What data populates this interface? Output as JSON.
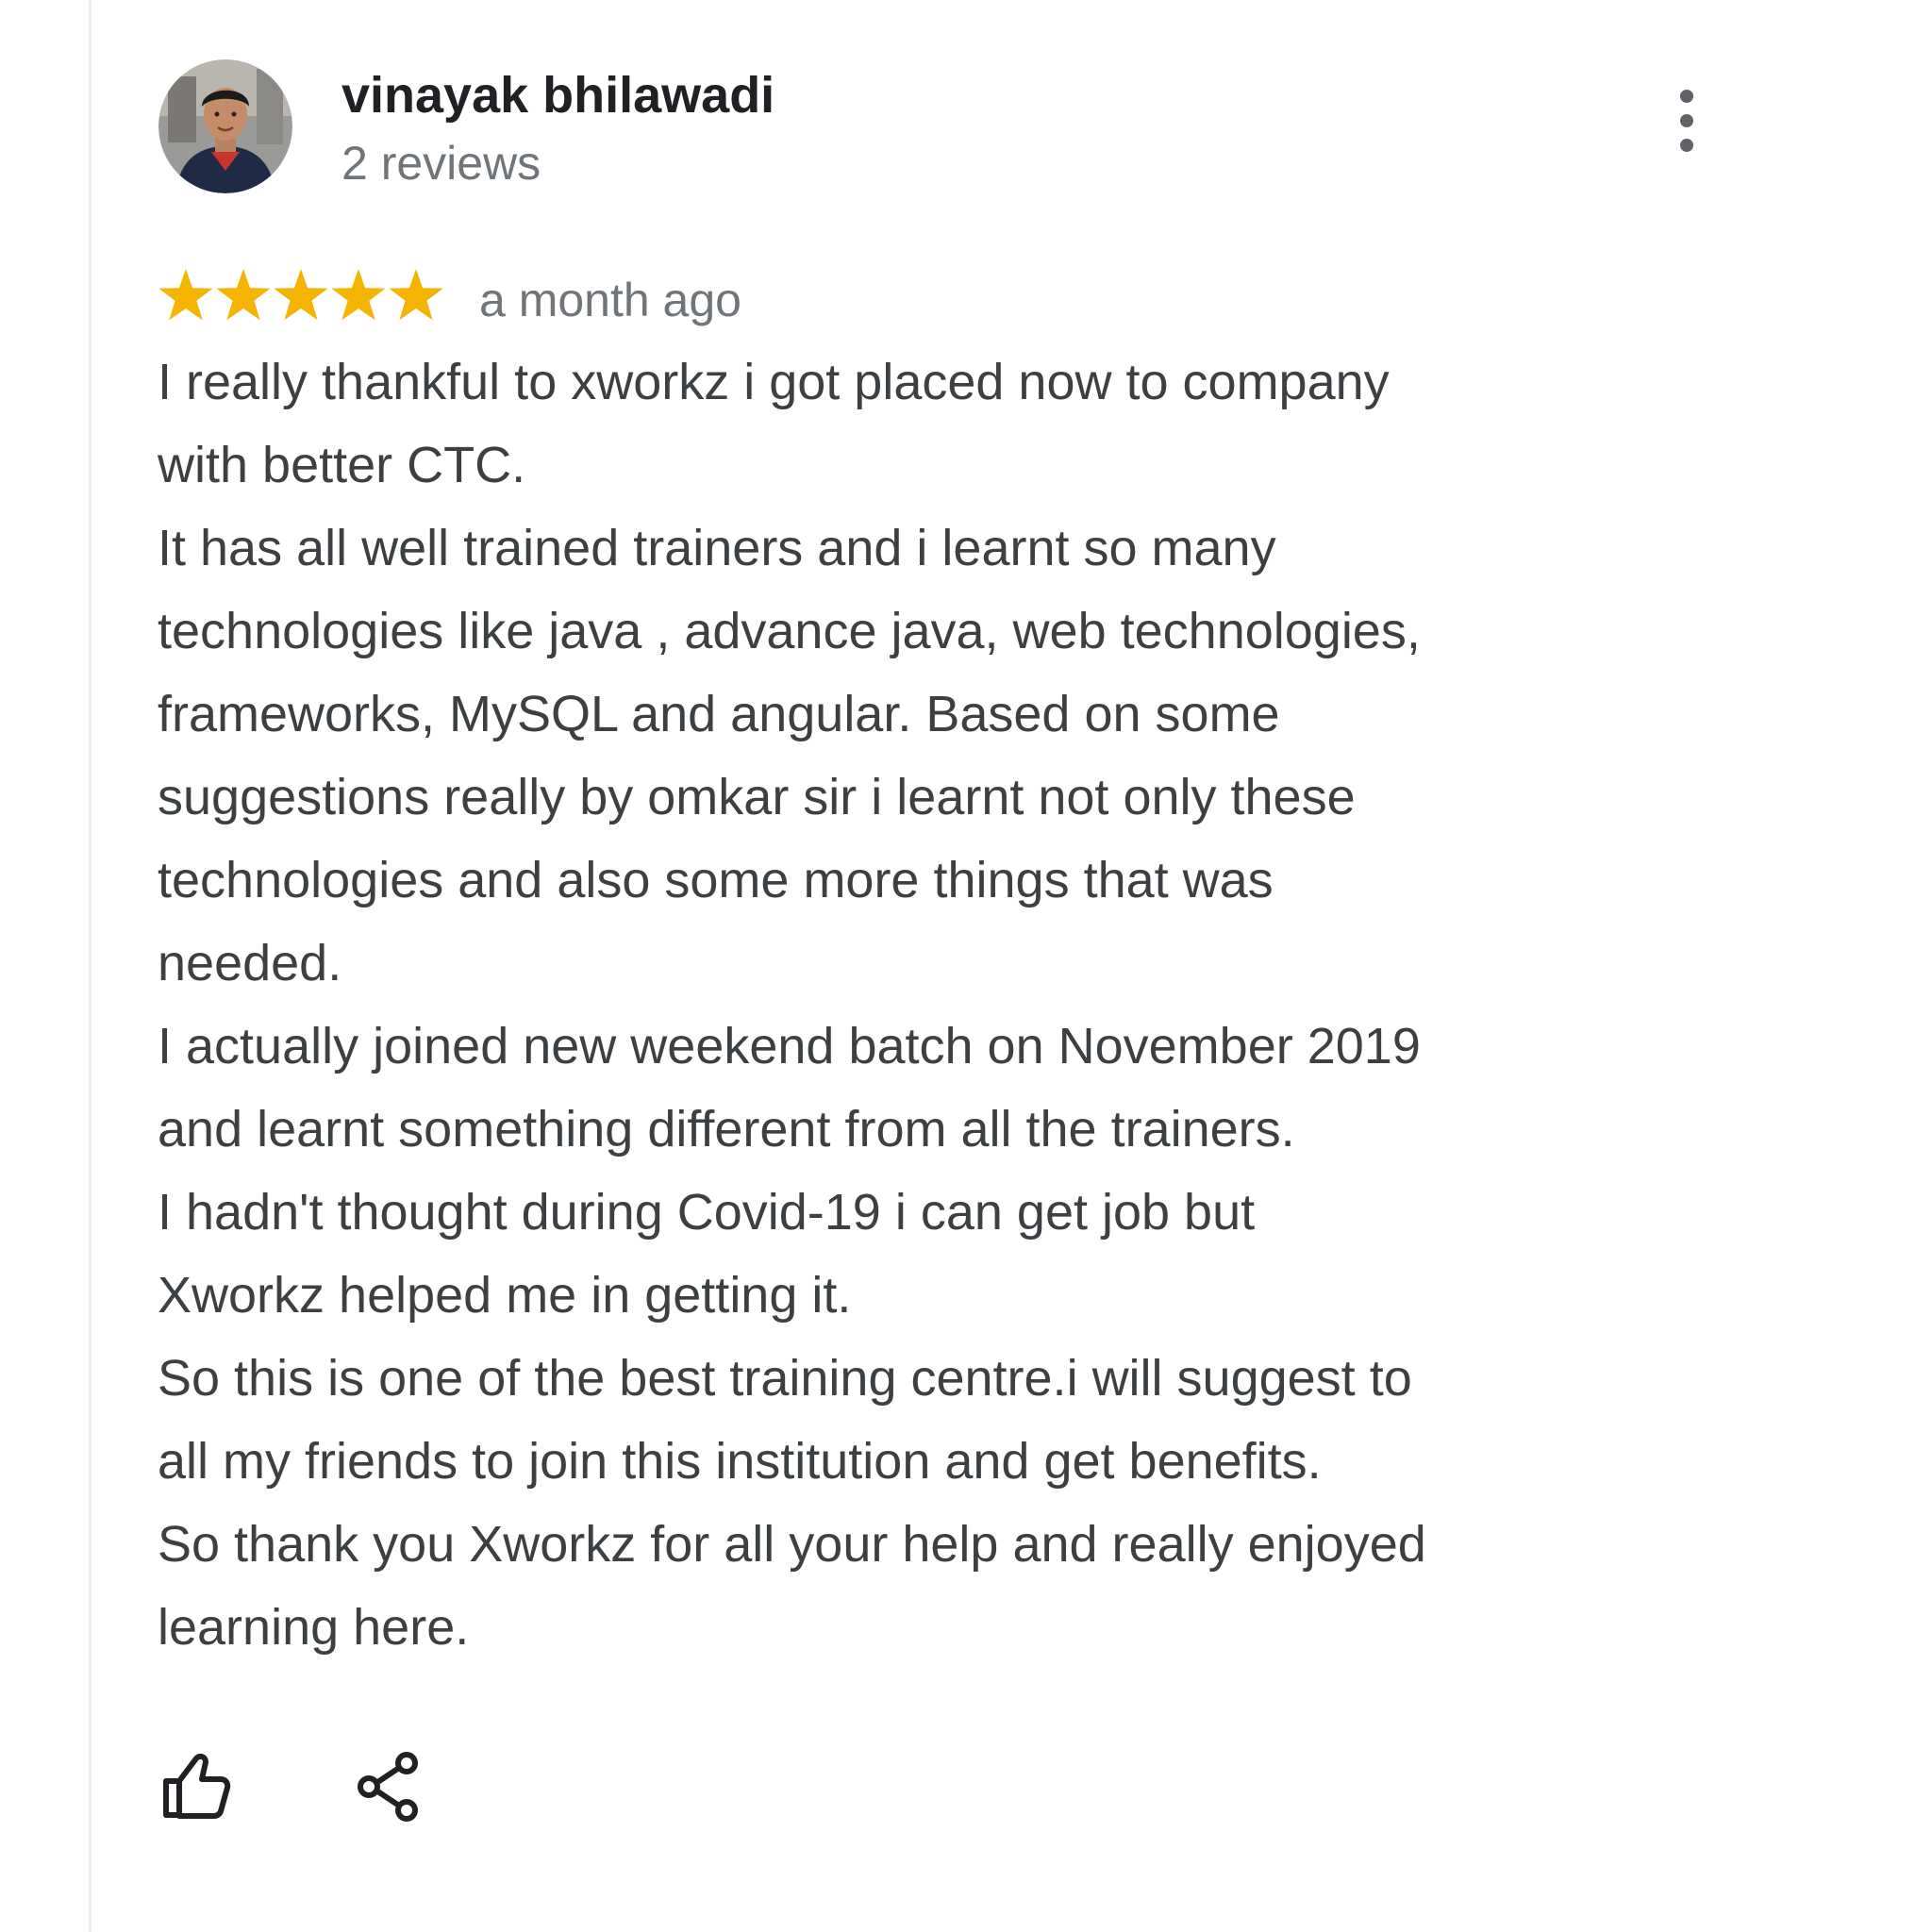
{
  "review": {
    "author": {
      "name": "vinayak bhilawadi",
      "meta": "2 reviews"
    },
    "rating": 5,
    "date": "a month ago",
    "lines": [
      "I really thankful to xworkz i got placed now to company",
      "with better CTC.",
      "It has all well trained trainers and i learnt so many",
      "technologies like  java , advance java, web technologies,",
      "frameworks, MySQL and angular. Based on some",
      "suggestions really by omkar sir i learnt not only these",
      "technologies and also some more things that was",
      "needed.",
      "I actually joined new weekend batch on November 2019",
      "and learnt something different from all the trainers.",
      "I hadn't thought during Covid-19 i can get job but",
      "Xworkz helped me in getting it.",
      "So this is one of the best training centre.i will suggest to",
      "all my friends to join this institution and get benefits.",
      "So thank you Xworkz for all your help and really enjoyed",
      "learning here."
    ]
  },
  "icons": {
    "menu": "more-vert-icon",
    "like": "thumb-up-icon",
    "share": "share-icon",
    "star": "star-icon"
  },
  "colors": {
    "star": "#f4b400",
    "primary_text": "#202124",
    "body_text": "#3c4043",
    "secondary_text": "#70757a"
  }
}
